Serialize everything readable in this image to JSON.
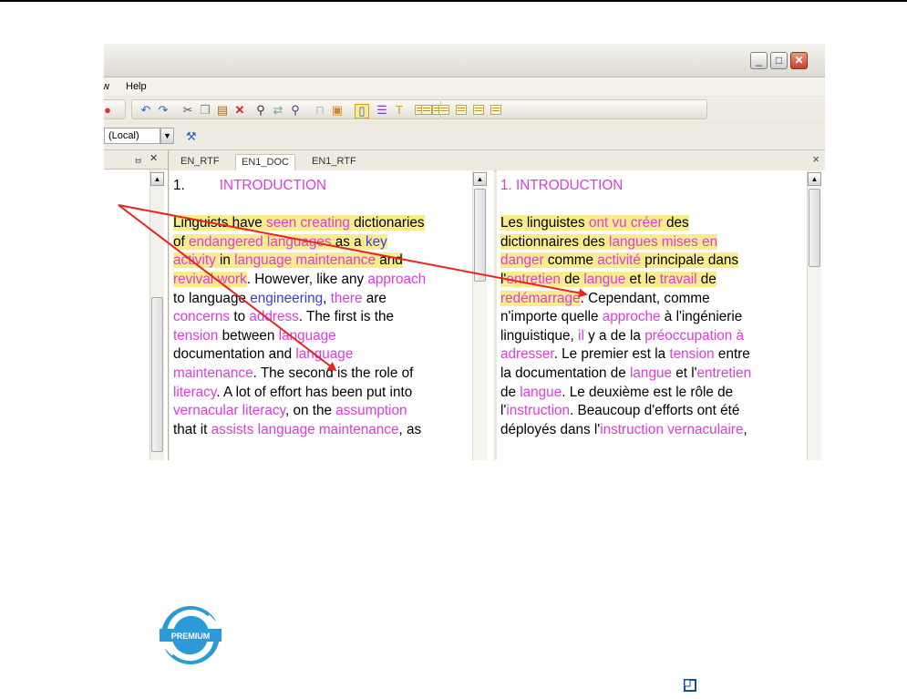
{
  "menu": {
    "partial": "w",
    "help": "Help"
  },
  "toolbar2": {
    "database_select": "(Local)"
  },
  "tabs": [
    "EN_RTF",
    "EN1_DOC",
    "EN1_RTF"
  ],
  "close_tabs": "×",
  "pane_pin": "ㅂ",
  "pane_close": "✕",
  "left_doc": {
    "heading_num": "1.",
    "heading": "INTRODUCTION",
    "lines": [
      [
        {
          "t": "Linguists have ",
          "c": "hl"
        },
        {
          "t": "seen creating",
          "c": "mg hl"
        },
        {
          "t": " dictionaries",
          "c": "hl"
        }
      ],
      [
        {
          "t": "of ",
          "c": "hl"
        },
        {
          "t": "endangered languages",
          "c": "mg hl"
        },
        {
          "t": " as a ",
          "c": "hl"
        },
        {
          "t": "key",
          "c": "bl hl"
        }
      ],
      [
        {
          "t": "activity",
          "c": "mg hl"
        },
        {
          "t": " in ",
          "c": "hl"
        },
        {
          "t": "language maintenance",
          "c": "mg hl"
        },
        {
          "t": " and",
          "c": "hl"
        }
      ],
      [
        {
          "t": "revival work",
          "c": "mg hl"
        },
        {
          "t": ". However, like any ",
          "c": ""
        },
        {
          "t": "approach",
          "c": "mg"
        }
      ],
      [
        {
          "t": "to language ",
          "c": ""
        },
        {
          "t": "engineering",
          "c": "bl"
        },
        {
          "t": ", ",
          "c": ""
        },
        {
          "t": "there",
          "c": "mg"
        },
        {
          "t": " are",
          "c": ""
        }
      ],
      [
        {
          "t": "concerns",
          "c": "mg"
        },
        {
          "t": " to ",
          "c": ""
        },
        {
          "t": "address",
          "c": "mg"
        },
        {
          "t": ". The first is the",
          "c": ""
        }
      ],
      [
        {
          "t": "tension",
          "c": "mg"
        },
        {
          "t": " between ",
          "c": ""
        },
        {
          "t": "language",
          "c": "mg"
        }
      ],
      [
        {
          "t": "documentation and ",
          "c": ""
        },
        {
          "t": "language",
          "c": "mg"
        }
      ],
      [
        {
          "t": "maintenance",
          "c": "mg"
        },
        {
          "t": ". The second is the role of",
          "c": ""
        }
      ],
      [
        {
          "t": "literacy",
          "c": "mg"
        },
        {
          "t": ". A lot of effort has been put into",
          "c": ""
        }
      ],
      [
        {
          "t": "vernacular literacy",
          "c": "mg"
        },
        {
          "t": ", on the ",
          "c": ""
        },
        {
          "t": "assumption",
          "c": "mg"
        }
      ],
      [
        {
          "t": "that it ",
          "c": ""
        },
        {
          "t": "assists language maintenance",
          "c": "mg"
        },
        {
          "t": ", as",
          "c": ""
        }
      ]
    ]
  },
  "right_doc": {
    "heading": "1. INTRODUCTION",
    "lines": [
      [
        {
          "t": "Les linguistes ",
          "c": "hl"
        },
        {
          "t": "ont vu créer",
          "c": "mg hl"
        },
        {
          "t": " des",
          "c": "hl"
        }
      ],
      [
        {
          "t": "dictionnaires des ",
          "c": "hl"
        },
        {
          "t": "langues mises en",
          "c": "mg hl"
        }
      ],
      [
        {
          "t": "danger",
          "c": "mg hl"
        },
        {
          "t": " comme ",
          "c": "hl"
        },
        {
          "t": "activité",
          "c": "mg hl"
        },
        {
          "t": " principale dans",
          "c": "hl"
        }
      ],
      [
        {
          "t": "l'",
          "c": "hl"
        },
        {
          "t": "entretien",
          "c": "mg hl"
        },
        {
          "t": " de ",
          "c": "hl"
        },
        {
          "t": "langue",
          "c": "mg hl"
        },
        {
          "t": " et le ",
          "c": "hl"
        },
        {
          "t": "travail",
          "c": "mg hl"
        },
        {
          "t": " de",
          "c": "hl"
        }
      ],
      [
        {
          "t": "redémarrage",
          "c": "mg hl"
        },
        {
          "t": ". Cependant, comme",
          "c": ""
        }
      ],
      [
        {
          "t": "n'importe quelle ",
          "c": ""
        },
        {
          "t": "approche",
          "c": "mg"
        },
        {
          "t": " à l'ingénierie",
          "c": ""
        }
      ],
      [
        {
          "t": "linguistique, ",
          "c": ""
        },
        {
          "t": "il",
          "c": "mg"
        },
        {
          "t": " y a de la ",
          "c": ""
        },
        {
          "t": "préoccupation à",
          "c": "mg"
        }
      ],
      [
        {
          "t": "adresser",
          "c": "mg"
        },
        {
          "t": ". Le premier est la ",
          "c": ""
        },
        {
          "t": "tension",
          "c": "mg"
        },
        {
          "t": " entre",
          "c": ""
        }
      ],
      [
        {
          "t": "la documentation de ",
          "c": ""
        },
        {
          "t": "langue",
          "c": "mg"
        },
        {
          "t": " et l'",
          "c": ""
        },
        {
          "t": "entretien",
          "c": "mg"
        }
      ],
      [
        {
          "t": "de ",
          "c": ""
        },
        {
          "t": "langue",
          "c": "mg"
        },
        {
          "t": ". Le deuxième est le rôle de",
          "c": ""
        }
      ],
      [
        {
          "t": "l'",
          "c": ""
        },
        {
          "t": "instruction",
          "c": "mg"
        },
        {
          "t": ". Beaucoup d'efforts ont été",
          "c": ""
        }
      ],
      [
        {
          "t": "déployés dans l'",
          "c": ""
        },
        {
          "t": "instruction vernaculaire",
          "c": "mg"
        },
        {
          "t": ",",
          "c": ""
        }
      ]
    ]
  },
  "badge": {
    "text": "PREMIUM"
  },
  "colors": {
    "magenta": "#e23ae2",
    "blue": "#3a3ae8",
    "highlight": "#f9ec8c",
    "arrow": "#e8251f"
  }
}
